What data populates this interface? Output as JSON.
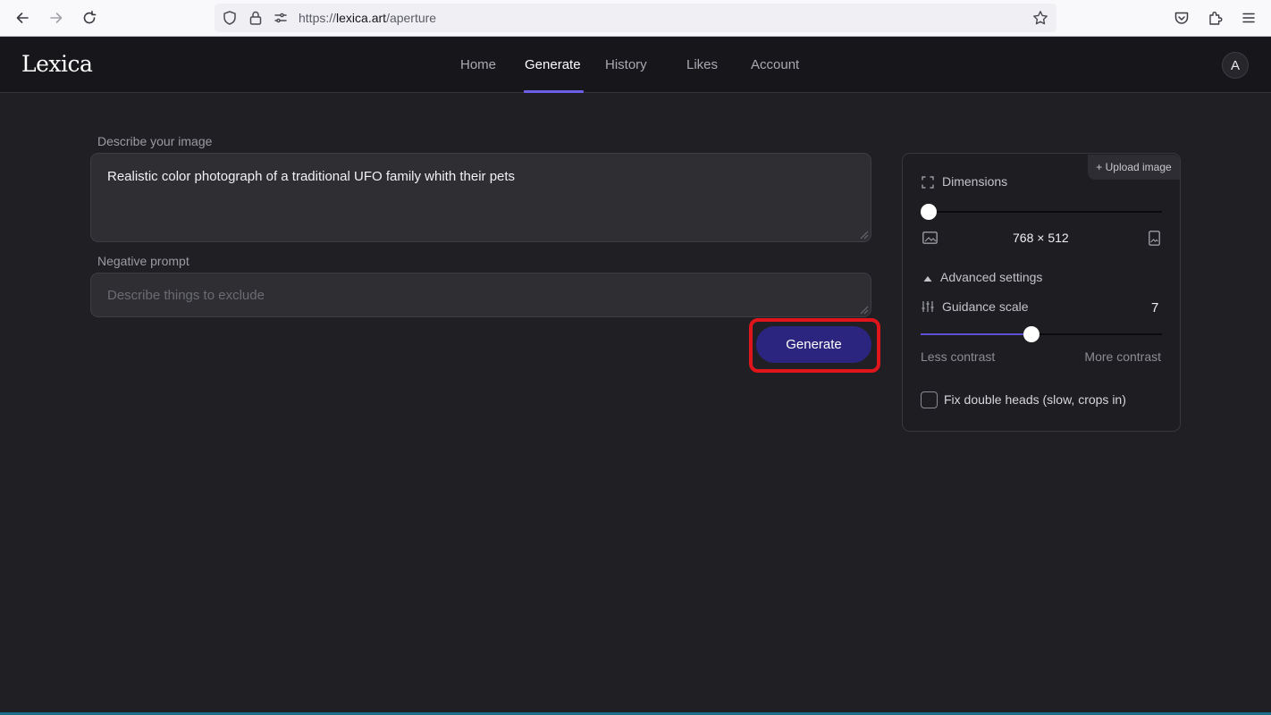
{
  "browser": {
    "url_prefix": "https://",
    "url_host": "lexica.art",
    "url_path": "/aperture"
  },
  "header": {
    "logo": "Lexica",
    "nav": [
      "Home",
      "Generate",
      "History",
      "Likes",
      "Account"
    ],
    "active_tab": "Generate",
    "avatar_initial": "A"
  },
  "prompt": {
    "label": "Describe your image",
    "value": "Realistic color photograph of a traditional UFO family whith their pets"
  },
  "negative_prompt": {
    "label": "Negative prompt",
    "placeholder": "Describe things to exclude"
  },
  "generate_button": "Generate",
  "settings": {
    "upload_label": "+ Upload image",
    "dimensions_label": "Dimensions",
    "dimensions_value": "768 × 512",
    "dimensions_slider_fraction": 0,
    "advanced_label": "Advanced settings",
    "guidance_label": "Guidance scale",
    "guidance_value": "7",
    "guidance_slider_fraction": 0.46,
    "less_contrast": "Less contrast",
    "more_contrast": "More contrast",
    "fix_double_heads_label": "Fix double heads (slow, crops in)",
    "fix_double_heads_checked": false
  },
  "colors": {
    "accent": "#6d5ee8",
    "button": "#2c2580",
    "highlight": "#e0141b",
    "background": "#202024"
  },
  "icons": {
    "back": "arrow-left-icon",
    "forward": "arrow-right-icon",
    "reload": "reload-icon",
    "shield": "shield-icon",
    "lock": "lock-icon",
    "permissions": "permissions-icon",
    "bookmark": "star-icon",
    "pocket": "pocket-icon",
    "extensions": "puzzle-icon",
    "menu": "hamburger-menu-icon",
    "dimensions": "expand-icon",
    "landscape": "landscape-image-icon",
    "portrait": "portrait-image-icon",
    "caret": "caret-up-icon",
    "guidance": "sliders-icon"
  }
}
